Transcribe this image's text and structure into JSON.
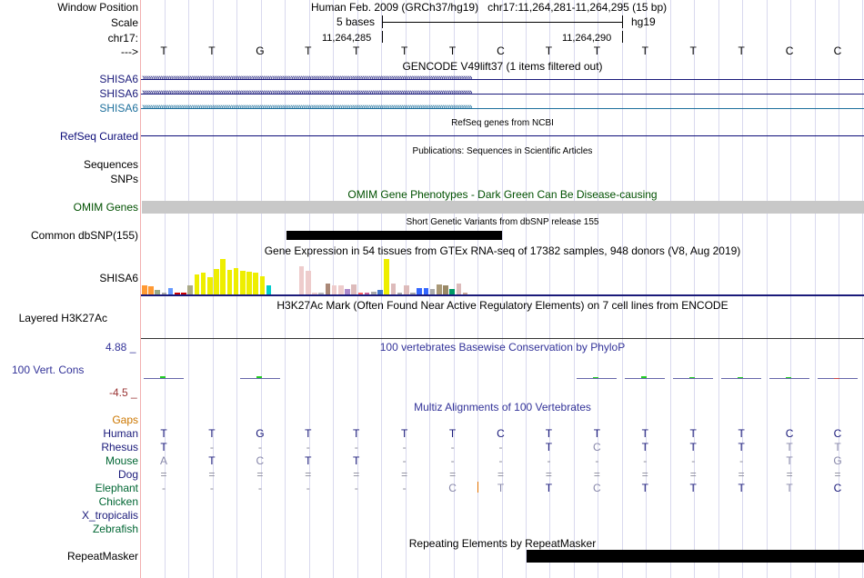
{
  "ruler": {
    "window_position_label": "Window Position",
    "scale_label": "Scale",
    "chrom_label": "chr17:",
    "arrow_label": "--->",
    "title": "Human Feb. 2009 (GRCh37/hg19)   chr17:11,264,281-11,264,295 (15 bp)",
    "scale_text": "5 bases",
    "assembly": "hg19",
    "pos_left": "11,264,285",
    "pos_right": "11,264,290",
    "bases": [
      "T",
      "T",
      "G",
      "T",
      "T",
      "T",
      "T",
      "C",
      "T",
      "T",
      "T",
      "T",
      "T",
      "C",
      "C"
    ]
  },
  "gencode": {
    "title": "GENCODE V49lift37 (1 items filtered out)",
    "genes": [
      {
        "label": "SHISA6",
        "color": "#1a1a7a"
      },
      {
        "label": "SHISA6",
        "color": "#1a1a7a"
      },
      {
        "label": "SHISA6",
        "color": "#1d6f9c"
      }
    ]
  },
  "refseq": {
    "title": "RefSeq genes from NCBI",
    "label": "RefSeq Curated",
    "color": "#0c0c78"
  },
  "publications": {
    "title": "Publications: Sequences in Scientific Articles",
    "label1": "Sequences",
    "label2": "SNPs"
  },
  "omim": {
    "title": "OMIM Gene Phenotypes - Dark Green Can Be Disease-causing",
    "label": "OMIM Genes",
    "color": "#005000"
  },
  "dbsnp": {
    "title": "Short Genetic Variants from dbSNP release 155",
    "label": "Common dbSNP(155)"
  },
  "gtex": {
    "title": "Gene Expression in 54 tissues from GTEx RNA-seq of 17382 samples, 948 donors (V8, Aug 2019)",
    "label": "SHISA6",
    "bars": [
      {
        "v": 0.26,
        "c": "#ff9933"
      },
      {
        "v": 0.22,
        "c": "#ff9933"
      },
      {
        "v": 0.12,
        "c": "#99aa88"
      },
      {
        "v": 0.04,
        "c": "#aaaaaa"
      },
      {
        "v": 0.17,
        "c": "#6699ff"
      },
      {
        "v": 0.05,
        "c": "#cc0000"
      },
      {
        "v": 0.05,
        "c": "#cc0000"
      },
      {
        "v": 0.25,
        "c": "#aaaa88"
      },
      {
        "v": 0.56,
        "c": "#eeee00"
      },
      {
        "v": 0.61,
        "c": "#eeee00"
      },
      {
        "v": 0.47,
        "c": "#eeee00"
      },
      {
        "v": 0.69,
        "c": "#eeee00"
      },
      {
        "v": 0.98,
        "c": "#eeee00"
      },
      {
        "v": 0.67,
        "c": "#eeee00"
      },
      {
        "v": 0.73,
        "c": "#eeee00"
      },
      {
        "v": 0.65,
        "c": "#eeee00"
      },
      {
        "v": 0.62,
        "c": "#eeee00"
      },
      {
        "v": 0.6,
        "c": "#eeee00"
      },
      {
        "v": 0.5,
        "c": "#eeee00"
      },
      {
        "v": 0.26,
        "c": "#00cccc"
      },
      {
        "v": 0.04,
        "c": "#ffffff"
      },
      {
        "v": 0.04,
        "c": "#ffffff"
      },
      {
        "v": 0.04,
        "c": "#ffffff"
      },
      {
        "v": 0.04,
        "c": "#ffffff"
      },
      {
        "v": 0.78,
        "c": "#eecccc"
      },
      {
        "v": 0.64,
        "c": "#eecccc"
      },
      {
        "v": 0.06,
        "c": "#eecccc"
      },
      {
        "v": 0.06,
        "c": "#bbbbbb"
      },
      {
        "v": 0.3,
        "c": "#aa8877"
      },
      {
        "v": 0.25,
        "c": "#eecccc"
      },
      {
        "v": 0.26,
        "c": "#eecccc"
      },
      {
        "v": 0.15,
        "c": "#aa88cc"
      },
      {
        "v": 0.28,
        "c": "#ddbbbb"
      },
      {
        "v": 0.05,
        "c": "#ff6666"
      },
      {
        "v": 0.05,
        "c": "#cc6699"
      },
      {
        "v": 0.08,
        "c": "#aaaaaa"
      },
      {
        "v": 0.12,
        "c": "#4477cc"
      },
      {
        "v": 0.98,
        "c": "#eeee00"
      },
      {
        "v": 0.3,
        "c": "#ddbbbb"
      },
      {
        "v": 0.04,
        "c": "#aaaaaa"
      },
      {
        "v": 0.24,
        "c": "#ddbbbb"
      },
      {
        "v": 0.04,
        "c": "#aaaaaa"
      },
      {
        "v": 0.18,
        "c": "#3366ff"
      },
      {
        "v": 0.18,
        "c": "#3366ff"
      },
      {
        "v": 0.14,
        "c": "#aaaaaa"
      },
      {
        "v": 0.28,
        "c": "#aa9977"
      },
      {
        "v": 0.24,
        "c": "#998866"
      },
      {
        "v": 0.14,
        "c": "#009966"
      },
      {
        "v": 0.3,
        "c": "#ddbbbb"
      },
      {
        "v": 0.04,
        "c": "#ccaa99"
      }
    ]
  },
  "h3k27ac": {
    "title": "H3K27Ac Mark (Often Found Near Active Regulatory Elements) on 7 cell lines from ENCODE",
    "label": "Layered H3K27Ac"
  },
  "phylop": {
    "title": "100 vertebrates Basewise Conservation by PhyloP",
    "label": "100 Vert. Cons",
    "max_label": "4.88 _",
    "min_label": "-4.5 _",
    "color": "#333399",
    "values": [
      0.3,
      0,
      0.3,
      0,
      0,
      0,
      0,
      0,
      0,
      0.15,
      0.4,
      0.2,
      0.15,
      0.15,
      -0.1
    ]
  },
  "multiz": {
    "title": "Multiz Alignments of 100 Vertebrates",
    "gaps_label": "Gaps",
    "species": [
      {
        "name": "Human",
        "color": "#1a1a7a",
        "bases": [
          "T",
          "T",
          "G",
          "T",
          "T",
          "T",
          "T",
          "C",
          "T",
          "T",
          "T",
          "T",
          "T",
          "C",
          "C"
        ]
      },
      {
        "name": "Rhesus",
        "color": "#1a1a7a",
        "bases": [
          "T",
          "-",
          "-",
          "-",
          "-",
          "-",
          "-",
          "-",
          "T",
          "C",
          "T",
          "T",
          "T",
          "T",
          "T"
        ]
      },
      {
        "name": "Mouse",
        "color": "#006633",
        "bases": [
          "A",
          "T",
          "C",
          "T",
          "T",
          "-",
          "-",
          "-",
          "-",
          "-",
          "-",
          "-",
          "-",
          "T",
          "G"
        ]
      },
      {
        "name": "Dog",
        "color": "#1a1a7a",
        "bases": [
          "=",
          "=",
          "=",
          "=",
          "=",
          "=",
          "=",
          "=",
          "=",
          "=",
          "=",
          "=",
          "=",
          "=",
          "="
        ]
      },
      {
        "name": "Elephant",
        "color": "#006633",
        "bases": [
          "-",
          "-",
          "-",
          "-",
          "-",
          "-",
          "C",
          "T",
          "T",
          "C",
          "T",
          "T",
          "T",
          "T",
          "C"
        ]
      },
      {
        "name": "Chicken",
        "color": "#006633",
        "bases": []
      },
      {
        "name": "X_tropicalis",
        "color": "#1a1a7a",
        "bases": []
      },
      {
        "name": "Zebrafish",
        "color": "#006633",
        "bases": []
      }
    ]
  },
  "repeatmasker": {
    "title": "Repeating Elements by RepeatMasker",
    "label": "RepeatMasker"
  }
}
